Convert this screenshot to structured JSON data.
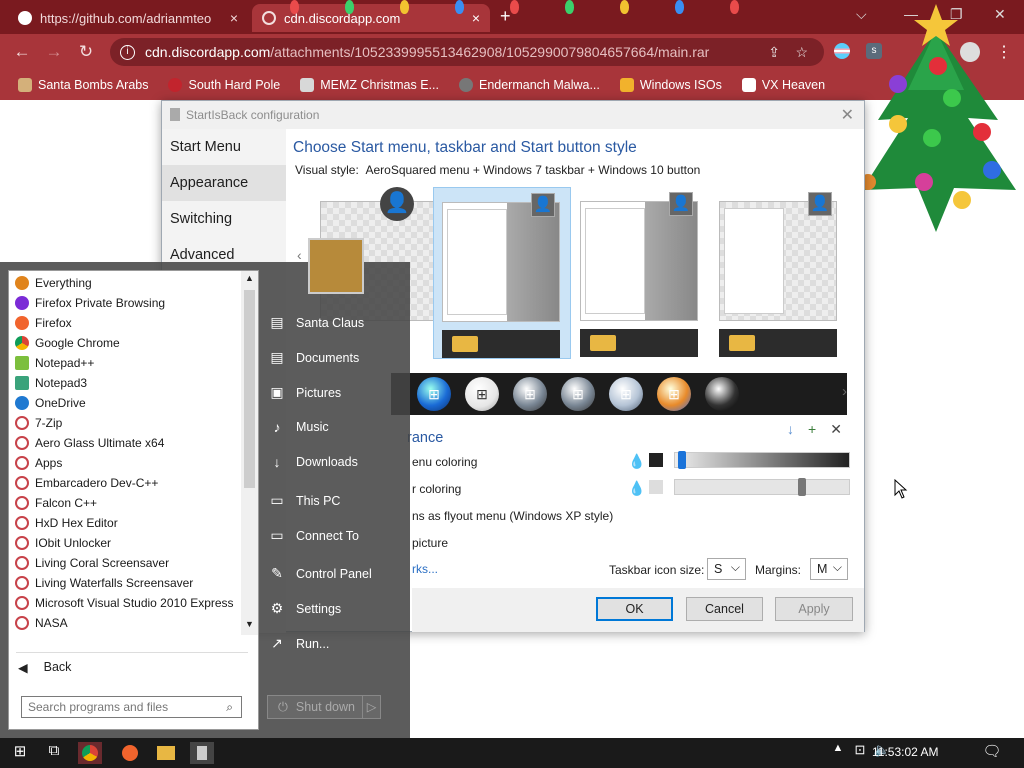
{
  "browser": {
    "tabs": [
      {
        "label": "https://github.com/adrianmteo",
        "close": "×"
      },
      {
        "label": "cdn.discordapp.com",
        "close": "×"
      }
    ],
    "new_tab": "+",
    "window_controls": [
      "⌵",
      "—",
      "❐",
      "✕"
    ],
    "url_host": "cdn.discordapp.com",
    "url_path": "/attachments/1052339995513462908/1052990079804657664/main.rar",
    "bookmarks": [
      {
        "label": "Santa Bombs Arabs",
        "color": "#d4b07a"
      },
      {
        "label": "South Hard Pole",
        "color": "#c2242d"
      },
      {
        "label": "MEMZ Christmas E...",
        "color": "#d8d8d8"
      },
      {
        "label": "Endermanch Malwa...",
        "color": "#777777"
      },
      {
        "label": "Windows ISOs",
        "color": "#f2b22c"
      },
      {
        "label": "VX Heaven",
        "color": "#ffffff"
      }
    ]
  },
  "dialog": {
    "title": "StartIsBack configuration",
    "close": "✕",
    "nav": [
      "Start Menu",
      "Appearance",
      "Switching",
      "Advanced"
    ],
    "heading": "Choose Start menu, taskbar and Start button style",
    "visual_style_label": "Visual style:",
    "visual_style_value": "AeroSquared menu + Windows 7 taskbar + Windows 10 button",
    "adv_heading": "rance",
    "option1": "enu coloring",
    "option2": "r coloring",
    "option3": "ns as flyout menu (Windows XP style)",
    "option4": "picture",
    "link": "rks...",
    "taskbar_icon_label": "Taskbar icon size:",
    "taskbar_icon_value": "S",
    "margins_label": "Margins:",
    "margins_value": "M",
    "ok": "OK",
    "cancel": "Cancel",
    "apply": "Apply",
    "slider1_level": 0.02,
    "slider2_level": 0.74
  },
  "startmenu": {
    "programs": [
      {
        "label": "Everything",
        "color": "#e0841c"
      },
      {
        "label": "Firefox Private Browsing",
        "color": "#7b2bd6"
      },
      {
        "label": "Firefox",
        "color": "#f1642d"
      },
      {
        "label": "Google Chrome",
        "color": "#2e9b4d"
      },
      {
        "label": "Notepad++",
        "color": "#7cbf3d"
      },
      {
        "label": "Notepad3",
        "color": "#3aa37b"
      },
      {
        "label": "OneDrive",
        "color": "#1f79d1"
      },
      {
        "label": "7-Zip",
        "color": "#c7424a"
      },
      {
        "label": "Aero Glass Ultimate x64",
        "color": "#c7424a"
      },
      {
        "label": "Apps",
        "color": "#c7424a"
      },
      {
        "label": "Embarcadero Dev-C++",
        "color": "#c7424a"
      },
      {
        "label": "Falcon C++",
        "color": "#c7424a"
      },
      {
        "label": "HxD Hex Editor",
        "color": "#c7424a"
      },
      {
        "label": "IObit Unlocker",
        "color": "#c7424a"
      },
      {
        "label": "Living Coral Screensaver",
        "color": "#c7424a"
      },
      {
        "label": "Living Waterfalls Screensaver",
        "color": "#c7424a"
      },
      {
        "label": "Microsoft Visual Studio 2010 Express",
        "color": "#c7424a"
      },
      {
        "label": "NASA",
        "color": "#c7424a"
      }
    ],
    "back": "Back",
    "search_placeholder": "Search programs and files",
    "side_items": [
      {
        "label": "Santa Claus",
        "icon": "user-icon"
      },
      {
        "label": "Documents",
        "icon": "documents-icon"
      },
      {
        "label": "Pictures",
        "icon": "pictures-icon"
      },
      {
        "label": "Music",
        "icon": "music-icon"
      },
      {
        "label": "Downloads",
        "icon": "downloads-icon"
      },
      {
        "label": "This PC",
        "icon": "computer-icon"
      },
      {
        "label": "Connect To",
        "icon": "connect-icon"
      },
      {
        "label": "Control Panel",
        "icon": "control-panel-icon"
      },
      {
        "label": "Settings",
        "icon": "gear-icon"
      },
      {
        "label": "Run...",
        "icon": "run-icon"
      }
    ],
    "shutdown": "Shut down"
  },
  "taskbar": {
    "time": "11:53:02 AM"
  }
}
